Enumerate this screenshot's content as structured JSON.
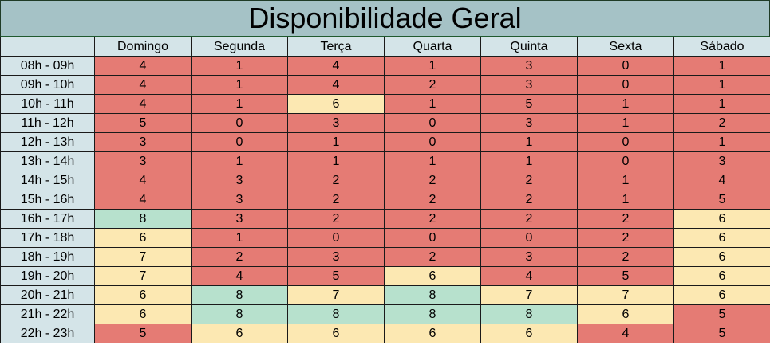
{
  "title": "Disponibilidade Geral",
  "colors": {
    "low": "#e57b74",
    "medium": "#fce8b2",
    "high": "#b7e1cd",
    "header": "#d4e4e8",
    "title_bg": "#a5c2c6"
  },
  "days": [
    "Domingo",
    "Segunda",
    "Terça",
    "Quarta",
    "Quinta",
    "Sexta",
    "Sábado"
  ],
  "rows": [
    {
      "slot": "08h - 09h",
      "values": [
        "4",
        "1",
        "4",
        "1",
        "3",
        "0",
        "1"
      ],
      "levels": [
        "low",
        "low",
        "low",
        "low",
        "low",
        "low",
        "low"
      ]
    },
    {
      "slot": "09h - 10h",
      "values": [
        "4",
        "1",
        "4",
        "2",
        "3",
        "0",
        "1"
      ],
      "levels": [
        "low",
        "low",
        "low",
        "low",
        "low",
        "low",
        "low"
      ]
    },
    {
      "slot": "10h - 11h",
      "values": [
        "4",
        "1",
        "6",
        "1",
        "5",
        "1",
        "1"
      ],
      "levels": [
        "low",
        "low",
        "medium",
        "low",
        "low",
        "low",
        "low"
      ]
    },
    {
      "slot": "11h - 12h",
      "values": [
        "5",
        "0",
        "3",
        "0",
        "3",
        "1",
        "2"
      ],
      "levels": [
        "low",
        "low",
        "low",
        "low",
        "low",
        "low",
        "low"
      ]
    },
    {
      "slot": "12h - 13h",
      "values": [
        "3",
        "0",
        "1",
        "0",
        "1",
        "0",
        "1"
      ],
      "levels": [
        "low",
        "low",
        "low",
        "low",
        "low",
        "low",
        "low"
      ]
    },
    {
      "slot": "13h - 14h",
      "values": [
        "3",
        "1",
        "1",
        "1",
        "1",
        "0",
        "3"
      ],
      "levels": [
        "low",
        "low",
        "low",
        "low",
        "low",
        "low",
        "low"
      ]
    },
    {
      "slot": "14h - 15h",
      "values": [
        "4",
        "3",
        "2",
        "2",
        "2",
        "1",
        "4"
      ],
      "levels": [
        "low",
        "low",
        "low",
        "low",
        "low",
        "low",
        "low"
      ]
    },
    {
      "slot": "15h - 16h",
      "values": [
        "4",
        "3",
        "2",
        "2",
        "2",
        "1",
        "5"
      ],
      "levels": [
        "low",
        "low",
        "low",
        "low",
        "low",
        "low",
        "low"
      ]
    },
    {
      "slot": "16h - 17h",
      "values": [
        "8",
        "3",
        "2",
        "2",
        "2",
        "2",
        "6"
      ],
      "levels": [
        "high",
        "low",
        "low",
        "low",
        "low",
        "low",
        "medium"
      ]
    },
    {
      "slot": "17h - 18h",
      "values": [
        "6",
        "1",
        "0",
        "0",
        "0",
        "2",
        "6"
      ],
      "levels": [
        "medium",
        "low",
        "low",
        "low",
        "low",
        "low",
        "medium"
      ]
    },
    {
      "slot": "18h - 19h",
      "values": [
        "7",
        "2",
        "3",
        "2",
        "3",
        "2",
        "6"
      ],
      "levels": [
        "medium",
        "low",
        "low",
        "low",
        "low",
        "low",
        "medium"
      ]
    },
    {
      "slot": "19h - 20h",
      "values": [
        "7",
        "4",
        "5",
        "6",
        "4",
        "5",
        "6"
      ],
      "levels": [
        "medium",
        "low",
        "low",
        "medium",
        "low",
        "low",
        "medium"
      ]
    },
    {
      "slot": "20h - 21h",
      "values": [
        "6",
        "8",
        "7",
        "8",
        "7",
        "7",
        "6"
      ],
      "levels": [
        "medium",
        "high",
        "medium",
        "high",
        "medium",
        "medium",
        "medium"
      ]
    },
    {
      "slot": "21h - 22h",
      "values": [
        "6",
        "8",
        "8",
        "8",
        "8",
        "6",
        "5"
      ],
      "levels": [
        "medium",
        "high",
        "high",
        "high",
        "high",
        "medium",
        "low"
      ]
    },
    {
      "slot": "22h - 23h",
      "values": [
        "5",
        "6",
        "6",
        "6",
        "6",
        "4",
        "5"
      ],
      "levels": [
        "low",
        "medium",
        "medium",
        "medium",
        "medium",
        "low",
        "low"
      ]
    }
  ]
}
